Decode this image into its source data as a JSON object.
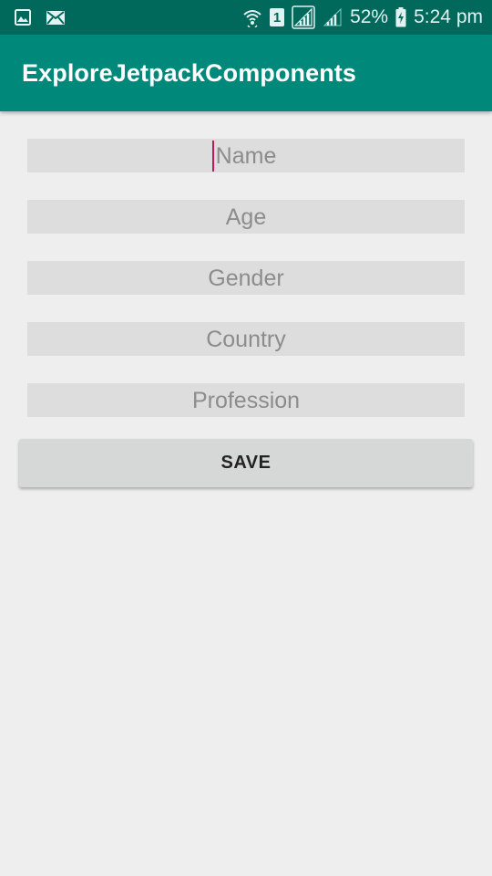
{
  "status_bar": {
    "battery": "52%",
    "time": "5:24 pm",
    "sim_label": "1",
    "icons": [
      "gallery-icon",
      "mail-icon",
      "wifi-icon",
      "sim-icon",
      "signal-icon",
      "signal-icon",
      "battery-charging-icon"
    ]
  },
  "app_bar": {
    "title": "ExploreJetpackComponents",
    "color": "#00897b"
  },
  "form": {
    "name": {
      "placeholder": "Name",
      "value": ""
    },
    "age": {
      "placeholder": "Age",
      "value": ""
    },
    "gender": {
      "placeholder": "Gender",
      "value": ""
    },
    "country": {
      "placeholder": "Country",
      "value": ""
    },
    "profession": {
      "placeholder": "Profession",
      "value": ""
    }
  },
  "save_label": "SAVE",
  "colors": {
    "status_bar": "#00695c",
    "accent": "#c2185b",
    "background": "#eeeeee"
  }
}
